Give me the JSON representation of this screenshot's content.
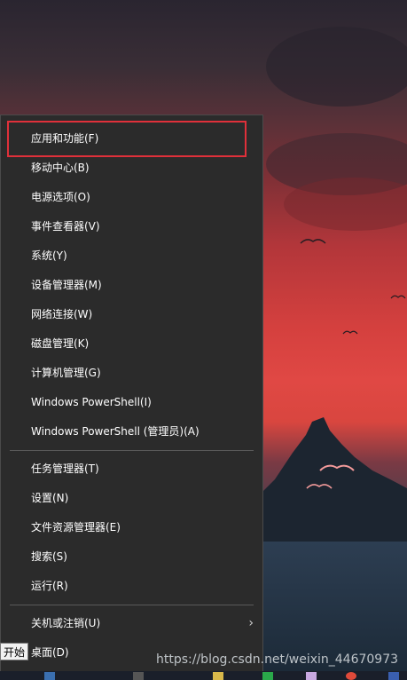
{
  "menu": {
    "items": [
      {
        "label": "应用和功能(F)"
      },
      {
        "label": "移动中心(B)"
      },
      {
        "label": "电源选项(O)"
      },
      {
        "label": "事件查看器(V)"
      },
      {
        "label": "系统(Y)"
      },
      {
        "label": "设备管理器(M)"
      },
      {
        "label": "网络连接(W)"
      },
      {
        "label": "磁盘管理(K)"
      },
      {
        "label": "计算机管理(G)"
      },
      {
        "label": "Windows PowerShell(I)"
      },
      {
        "label": "Windows PowerShell (管理员)(A)"
      },
      {
        "label": "任务管理器(T)"
      },
      {
        "label": "设置(N)"
      },
      {
        "label": "文件资源管理器(E)"
      },
      {
        "label": "搜索(S)"
      },
      {
        "label": "运行(R)"
      },
      {
        "label": "关机或注销(U)"
      },
      {
        "label": "桌面(D)"
      }
    ]
  },
  "tooltip": {
    "text": "开始"
  },
  "watermark": {
    "text": "https://blog.csdn.net/weixin_44670973"
  },
  "colors": {
    "highlight": "#e0303a",
    "menu_bg": "#2b2b2b"
  }
}
